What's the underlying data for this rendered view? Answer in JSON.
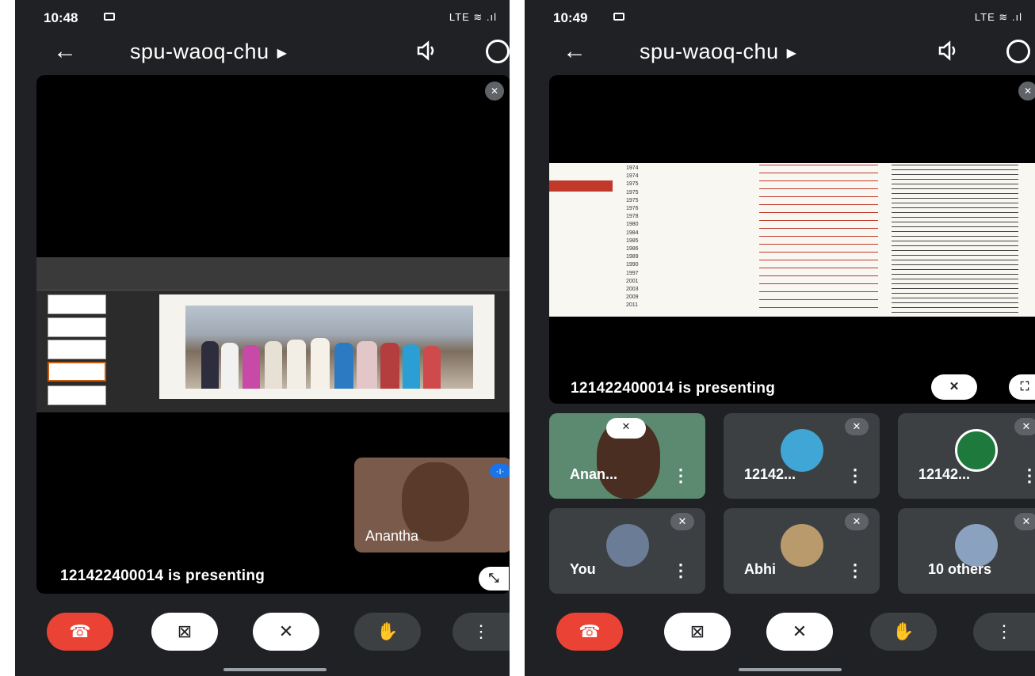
{
  "left": {
    "status_time": "10:48",
    "status_icons": "LTE ≋ .ıl",
    "meeting_code": "spu-waoq-chu",
    "presenting_text": "121422400014 is presenting",
    "self_view_name": "Anantha"
  },
  "right": {
    "status_time": "10:49",
    "status_icons": "LTE ≋ .ıl",
    "meeting_code": "spu-waoq-chu",
    "presenting_text": "121422400014 is presenting",
    "tiles": [
      {
        "name": "Anan...",
        "muted": false
      },
      {
        "name": "12142...",
        "muted": true
      },
      {
        "name": "12142...",
        "muted": true
      },
      {
        "name": "You",
        "muted": true
      },
      {
        "name": "Abhi",
        "muted": true
      },
      {
        "name": "10 others",
        "muted": true
      }
    ],
    "table_years": [
      "1974",
      "1974",
      "1975",
      "1975",
      "1975",
      "1976",
      "1978",
      "1980",
      "1984",
      "1985",
      "1986",
      "1989",
      "1990",
      "1997",
      "2001",
      "2003",
      "2009",
      "2011"
    ]
  },
  "icons": {
    "back": "arrow-left-icon",
    "title_caret": "▸",
    "speaker": "volume-icon",
    "switch_camera": "switch-camera-icon",
    "end_call": "phone-hangup-icon",
    "camera_off": "videocam-off-icon",
    "mic_off": "mic-off-icon",
    "raise_hand": "hand-icon",
    "more": "more-vert-icon",
    "pin_off": "pin-off-icon",
    "exit_fullscreen": "fullscreen-exit-icon",
    "fullscreen": "fullscreen-icon"
  },
  "colors": {
    "background": "#202124",
    "end_call": "#ea4335",
    "tile": "#3c4043"
  }
}
